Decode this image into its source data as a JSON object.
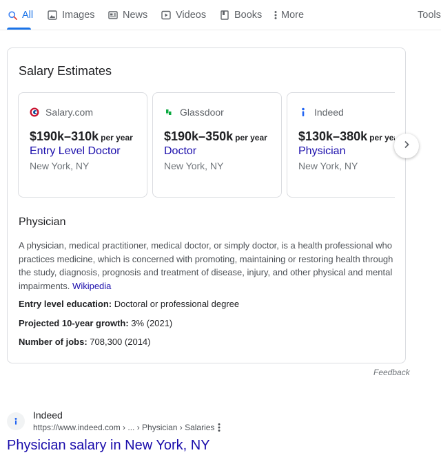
{
  "tabs": [
    {
      "label": "All",
      "icon": "search-icon",
      "active": true
    },
    {
      "label": "Images",
      "icon": "image-icon"
    },
    {
      "label": "News",
      "icon": "news-icon"
    },
    {
      "label": "Videos",
      "icon": "video-icon"
    },
    {
      "label": "Books",
      "icon": "book-icon"
    },
    {
      "label": "More",
      "icon": "more-vert-icon"
    }
  ],
  "tools_label": "Tools",
  "salary_card": {
    "title": "Salary Estimates",
    "estimates": [
      {
        "source": "Salary.com",
        "range": "$190k–310k",
        "period": "per year",
        "role": "Entry Level Doctor",
        "location": "New York, NY",
        "logo": "salary-com-logo"
      },
      {
        "source": "Glassdoor",
        "range": "$190k–350k",
        "period": "per year",
        "role": "Doctor",
        "location": "New York, NY",
        "logo": "glassdoor-logo"
      },
      {
        "source": "Indeed",
        "range": "$130k–380k",
        "period": "per year",
        "role": "Physician",
        "location": "New York, NY",
        "logo": "indeed-logo"
      }
    ],
    "subtitle": "Physician",
    "description": "A physician, medical practitioner, medical doctor, or simply doctor, is a health professional who practices medicine, which is concerned with promoting, maintaining or restoring health through the study, diagnosis, prognosis and treatment of disease, injury, and other physical and mental impairments.",
    "wiki_link": "Wikipedia",
    "facts": [
      {
        "label": "Entry level education:",
        "value": "Doctoral or professional degree"
      },
      {
        "label": "Projected 10-year growth:",
        "value": "3% (2021)"
      },
      {
        "label": "Number of jobs:",
        "value": "708,300 (2014)"
      }
    ]
  },
  "feedback_label": "Feedback",
  "result": {
    "site_name": "Indeed",
    "url": "https://www.indeed.com › ... › Physician › Salaries",
    "title": "Physician salary in New York, NY"
  },
  "colors": {
    "accent": "#1a73e8",
    "link": "#1a0dab",
    "muted": "#70757a"
  }
}
